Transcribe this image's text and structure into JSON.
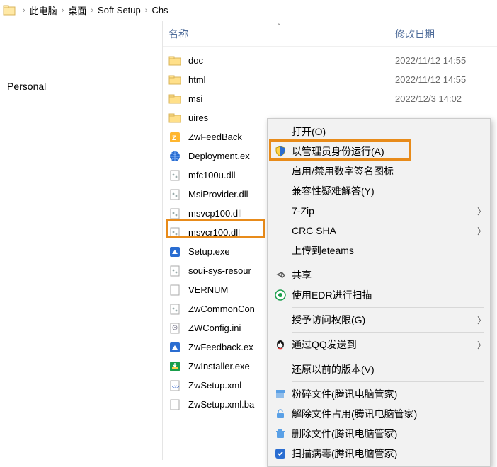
{
  "breadcrumb": {
    "items": [
      "此电脑",
      "桌面",
      "Soft Setup",
      "Chs"
    ]
  },
  "nav": {
    "personal": "Personal"
  },
  "columns": {
    "name": "名称",
    "date": "修改日期"
  },
  "files": [
    {
      "icon": "folder",
      "name": "doc",
      "date": "2022/11/12 14:55"
    },
    {
      "icon": "folder",
      "name": "html",
      "date": "2022/11/12 14:55"
    },
    {
      "icon": "folder",
      "name": "msi",
      "date": "2022/12/3 14:02"
    },
    {
      "icon": "folder",
      "name": "uires",
      "date": ""
    },
    {
      "icon": "exe-zw",
      "name": "ZwFeedBack",
      "date": ""
    },
    {
      "icon": "globe",
      "name": "Deployment.ex",
      "date": ""
    },
    {
      "icon": "dll",
      "name": "mfc100u.dll",
      "date": ""
    },
    {
      "icon": "dll",
      "name": "MsiProvider.dll",
      "date": ""
    },
    {
      "icon": "dll",
      "name": "msvcp100.dll",
      "date": ""
    },
    {
      "icon": "dll",
      "name": "msvcr100.dll",
      "date": ""
    },
    {
      "icon": "exe-setup",
      "name": "Setup.exe",
      "date": "",
      "selected": true
    },
    {
      "icon": "dll",
      "name": "soui-sys-resour",
      "date": ""
    },
    {
      "icon": "file",
      "name": "VERNUM",
      "date": ""
    },
    {
      "icon": "dll",
      "name": "ZwCommonCon",
      "date": ""
    },
    {
      "icon": "ini",
      "name": "ZWConfig.ini",
      "date": ""
    },
    {
      "icon": "exe-setup",
      "name": "ZwFeedback.ex",
      "date": ""
    },
    {
      "icon": "exe-inst",
      "name": "ZwInstaller.exe",
      "date": ""
    },
    {
      "icon": "xml",
      "name": "ZwSetup.xml",
      "date": ""
    },
    {
      "icon": "file",
      "name": "ZwSetup.xml.ba",
      "date": ""
    }
  ],
  "context_menu": [
    {
      "type": "item",
      "icon": "",
      "label": "打开(O)"
    },
    {
      "type": "item",
      "icon": "shield",
      "label": "以管理员身份运行(A)",
      "highlight": true
    },
    {
      "type": "item",
      "icon": "",
      "label": "启用/禁用数字签名图标"
    },
    {
      "type": "item",
      "icon": "",
      "label": "兼容性疑难解答(Y)"
    },
    {
      "type": "item",
      "icon": "",
      "label": "7-Zip",
      "submenu": true
    },
    {
      "type": "item",
      "icon": "",
      "label": "CRC SHA",
      "submenu": true
    },
    {
      "type": "item",
      "icon": "",
      "label": "上传到eteams"
    },
    {
      "type": "sep"
    },
    {
      "type": "item",
      "icon": "share",
      "label": "共享"
    },
    {
      "type": "item",
      "icon": "edr",
      "label": "使用EDR进行扫描"
    },
    {
      "type": "sep"
    },
    {
      "type": "item",
      "icon": "",
      "label": "授予访问权限(G)",
      "submenu": true
    },
    {
      "type": "sep"
    },
    {
      "type": "item",
      "icon": "qq",
      "label": "通过QQ发送到",
      "submenu": true
    },
    {
      "type": "sep"
    },
    {
      "type": "item",
      "icon": "",
      "label": "还原以前的版本(V)"
    },
    {
      "type": "sep"
    },
    {
      "type": "item",
      "icon": "shred",
      "label": "粉碎文件(腾讯电脑管家)"
    },
    {
      "type": "item",
      "icon": "unlock",
      "label": "解除文件占用(腾讯电脑管家)"
    },
    {
      "type": "item",
      "icon": "delete",
      "label": "删除文件(腾讯电脑管家)"
    },
    {
      "type": "item",
      "icon": "scan",
      "label": "扫描病毒(腾讯电脑管家)"
    }
  ]
}
